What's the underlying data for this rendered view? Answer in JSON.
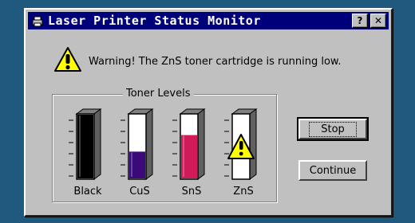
{
  "window": {
    "title": "Laser Printer Status Monitor",
    "help_label": "?",
    "close_label": "✕"
  },
  "warning": {
    "message": "Warning! The ZnS toner cartridge is running low."
  },
  "toner": {
    "group_label": "Toner Levels",
    "cartridges": [
      {
        "label": "Black",
        "color": "#000000",
        "level": 1.0,
        "warning": false
      },
      {
        "label": "CuS",
        "color": "#3a0a7a",
        "level": 0.42,
        "warning": false
      },
      {
        "label": "SnS",
        "color": "#d01a5a",
        "level": 0.68,
        "warning": false
      },
      {
        "label": "ZnS",
        "color": "#ffffff",
        "level": 0.0,
        "warning": true
      }
    ]
  },
  "buttons": {
    "stop_label": "Stop",
    "continue_label": "Continue"
  },
  "colors": {
    "desktop": "#1f5a7e",
    "titlebar": "#00007b",
    "warning_yellow": "#ffff00"
  }
}
